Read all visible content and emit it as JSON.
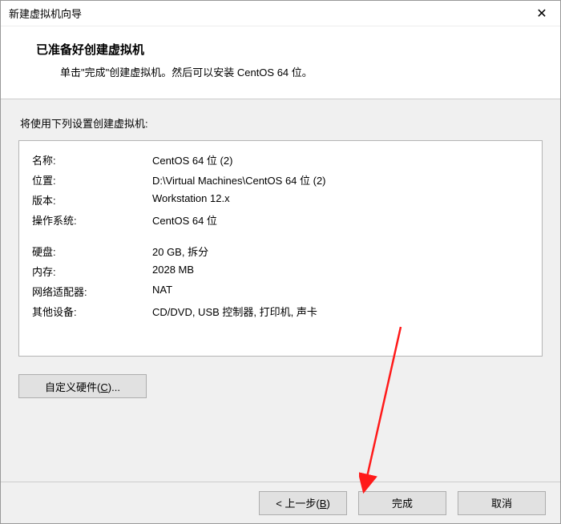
{
  "window": {
    "title": "新建虚拟机向导",
    "close_glyph": "✕"
  },
  "header": {
    "title": "已准备好创建虚拟机",
    "desc": "单击\"完成\"创建虚拟机。然后可以安装 CentOS 64 位。"
  },
  "intro": "将使用下列设置创建虚拟机:",
  "settings": {
    "name_label": "名称:",
    "name_value": "CentOS 64 位 (2)",
    "location_label": "位置:",
    "location_value": "D:\\Virtual Machines\\CentOS 64 位 (2)",
    "version_label": "版本:",
    "version_value": "Workstation 12.x",
    "os_label": "操作系统:",
    "os_value": "CentOS 64 位",
    "disk_label": "硬盘:",
    "disk_value": "20 GB, 拆分",
    "memory_label": "内存:",
    "memory_value": "2028 MB",
    "net_label": "网络适配器:",
    "net_value": "NAT",
    "other_label": "其他设备:",
    "other_value": "CD/DVD, USB 控制器, 打印机, 声卡"
  },
  "buttons": {
    "customize_prefix": "自定义硬件(",
    "customize_hotkey": "C",
    "customize_suffix": ")...",
    "back_prefix": "< 上一步(",
    "back_hotkey": "B",
    "back_suffix": ")",
    "finish": "完成",
    "cancel": "取消"
  }
}
